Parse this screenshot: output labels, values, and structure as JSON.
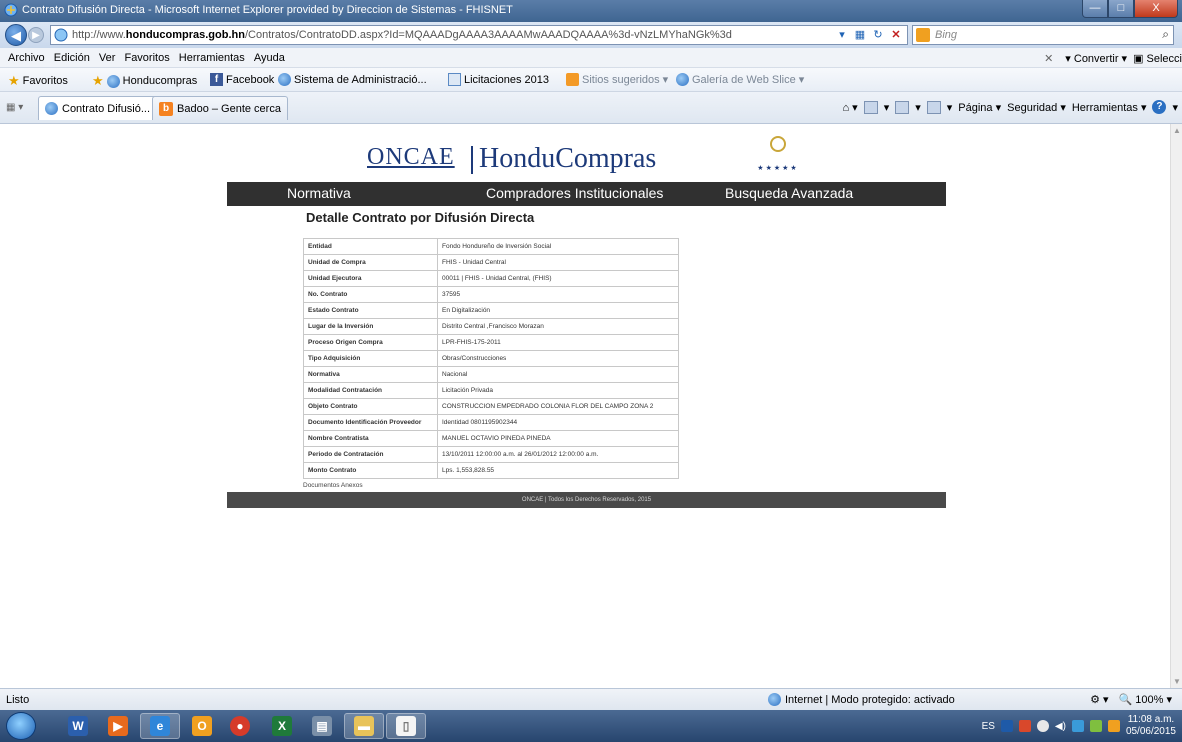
{
  "window": {
    "title": "Contrato Difusión Directa - Microsoft Internet Explorer provided by Direccion de Sistemas - FHISNET",
    "min": "—",
    "max": "□",
    "close": "X"
  },
  "address": {
    "url_prefix": "http://www.",
    "url_domain": "honducompras.gob.hn",
    "url_path": "/Contratos/ContratoDD.aspx?Id=MQAAADgAAAA3AAAAMwAAADQAAAA%3d-vNzLMYhaNGk%3d",
    "search_placeholder": "Bing"
  },
  "menu": {
    "items": [
      "Archivo",
      "Edición",
      "Ver",
      "Favoritos",
      "Herramientas",
      "Ayuda"
    ],
    "convertir": "Convertir",
    "seleccionar": "Selecci"
  },
  "favorites": {
    "label": "Favoritos",
    "items": [
      "Honducompras",
      "Facebook",
      "Sistema de Administració...",
      "Licitaciones 2013",
      "Sitios sugeridos",
      "Galería de Web Slice"
    ]
  },
  "tabs": {
    "active": "Contrato Difusió...",
    "inactive": "Badoo – Gente cerca"
  },
  "commandbar": {
    "pagina": "Página",
    "seguridad": "Seguridad",
    "herramientas": "Herramientas"
  },
  "site": {
    "logo_left": "ONCAE",
    "logo_right": "HonduCompras",
    "nav": [
      "Normativa",
      "Compradores Institucionales",
      "Busqueda Avanzada"
    ],
    "page_title": "Detalle Contrato por Difusión Directa",
    "rows": [
      {
        "k": "Entidad",
        "v": "Fondo Hondureño de Inversión Social"
      },
      {
        "k": "Unidad de Compra",
        "v": "FHIS - Unidad Central"
      },
      {
        "k": "Unidad Ejecutora",
        "v": "00011 | FHIS - Unidad Central, (FHIS)"
      },
      {
        "k": "No. Contrato",
        "v": "37595"
      },
      {
        "k": "Estado Contrato",
        "v": "En Digitalización"
      },
      {
        "k": "Lugar de la Inversión",
        "v": "Distrito Central ,Francisco Morazan"
      },
      {
        "k": "Proceso Origen Compra",
        "v": "LPR-FHIS-175-2011"
      },
      {
        "k": "Tipo Adquisición",
        "v": "Obras/Construcciones"
      },
      {
        "k": "Normativa",
        "v": "Nacional"
      },
      {
        "k": "Modalidad Contratación",
        "v": "Licitación Privada"
      },
      {
        "k": "Objeto Contrato",
        "v": "CONSTRUCCION EMPEDRADO COLONIA FLOR DEL CAMPO ZONA 2"
      },
      {
        "k": "Documento Identificación Proveedor",
        "v": "Identidad 0801195902344"
      },
      {
        "k": "Nombre Contratista",
        "v": "MANUEL OCTAVIO PINEDA PINEDA"
      },
      {
        "k": "Periodo de Contratación",
        "v": "13/10/2011 12:00:00 a.m. al 26/01/2012 12:00:00 a.m."
      },
      {
        "k": "Monto Contrato",
        "v": "Lps. 1,553,828.55"
      }
    ],
    "docs_link": "Documentos Anexos",
    "footer": "ONCAE | Todos los Derechos Reservados, 2015"
  },
  "status": {
    "text": "Listo",
    "zone": "Internet | Modo protegido: activado",
    "zoom": "100%"
  },
  "taskbar": {
    "lang": "ES",
    "time": "11:08 a.m.",
    "date": "05/06/2015"
  }
}
